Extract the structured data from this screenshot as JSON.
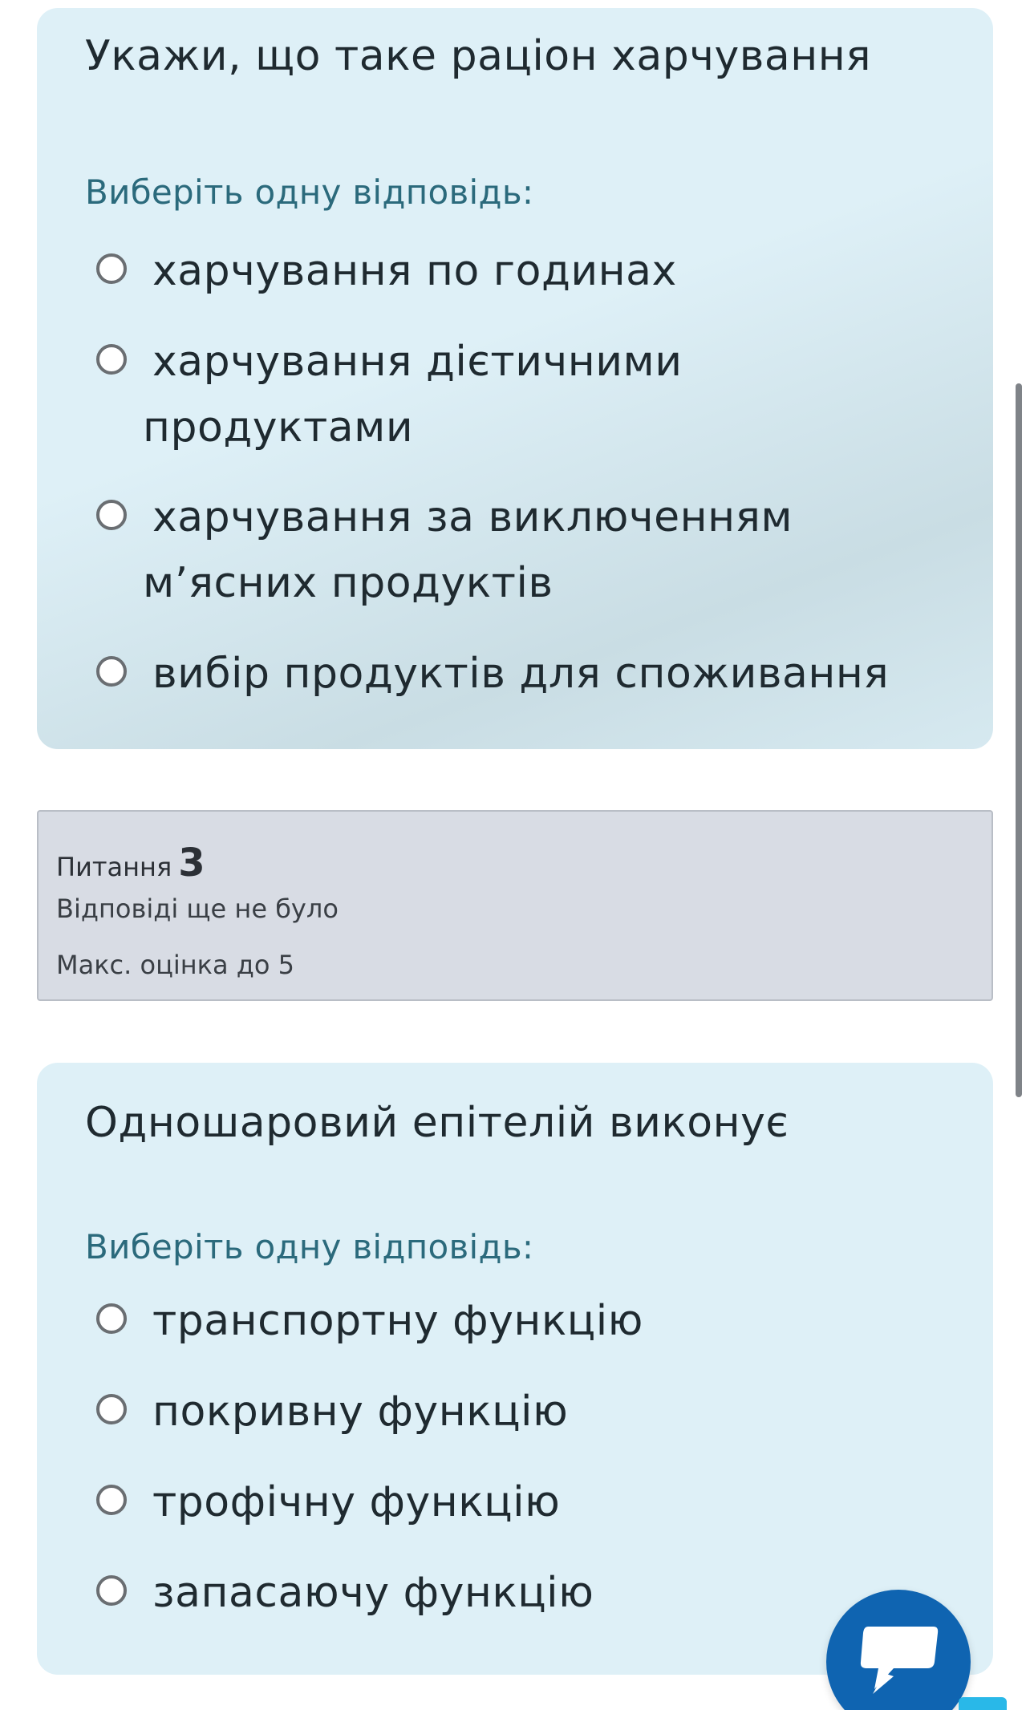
{
  "question2": {
    "text": "Укажи, що таке раціон харчування",
    "prompt": "Виберіть одну відповідь:",
    "answers": [
      {
        "line1": "харчування по годинах",
        "line2": ""
      },
      {
        "line1": "харчування дієтичними",
        "line2": "продуктами"
      },
      {
        "line1": "харчування за виключенням",
        "line2": "м’ясних продуктів"
      },
      {
        "line1": "вибір продуктів для споживання",
        "line2": ""
      }
    ]
  },
  "question3_info": {
    "label": "Питання",
    "number": "3",
    "state": "Відповіді ще не було",
    "grade": "Макс. оцінка до 5"
  },
  "question3": {
    "text": "Одношаровий епітелій виконує",
    "prompt": "Виберіть одну відповідь:",
    "answers": [
      {
        "line1": "транспортну функцію"
      },
      {
        "line1": "покривну функцію"
      },
      {
        "line1": "трофічну функцію"
      },
      {
        "line1": "запасаючу функцію"
      }
    ]
  },
  "icons": {
    "chat": "chat-bubble-icon",
    "radio": "radio-unchecked-icon"
  },
  "colors": {
    "card_bg": "#def0f7",
    "prompt": "#2b6a7c",
    "info_bg": "#d8dce4",
    "chat_button": "#0f64b1"
  }
}
